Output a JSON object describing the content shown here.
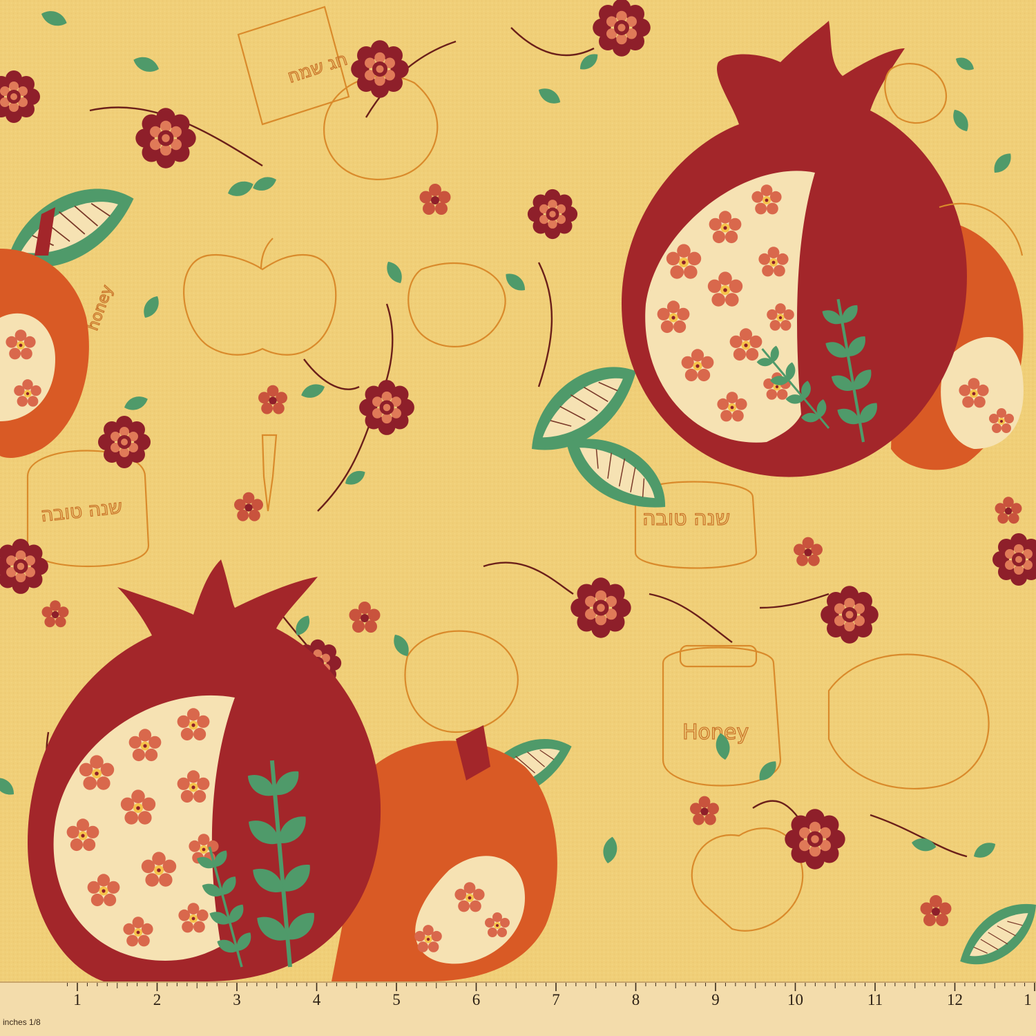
{
  "image": {
    "subject": "Fabric swatch with pomegranate, apple, flower and honey-jar pattern",
    "colors": {
      "background": "#f0cf78",
      "pomegranate": "#a3262a",
      "apple": "#d95a25",
      "seed_cream": "#f6e2b3",
      "leaf": "#4f9a6a",
      "flower_dark": "#8e1f2a",
      "flower_light": "#e07a58",
      "outline": "#d98a2b",
      "ruler": "#f3dcab"
    }
  },
  "texts": {
    "honey_upper": "honey",
    "honey_lower": "Honey",
    "hebrew_1": "חג שמח",
    "hebrew_2": "שנה טובה",
    "hebrew_3": "שנה טובה"
  },
  "ruler": {
    "unit_label": "inches 1/8",
    "numbers": [
      "1",
      "2",
      "3",
      "4",
      "5",
      "6",
      "7",
      "8",
      "9",
      "10",
      "11",
      "12",
      "1"
    ]
  }
}
